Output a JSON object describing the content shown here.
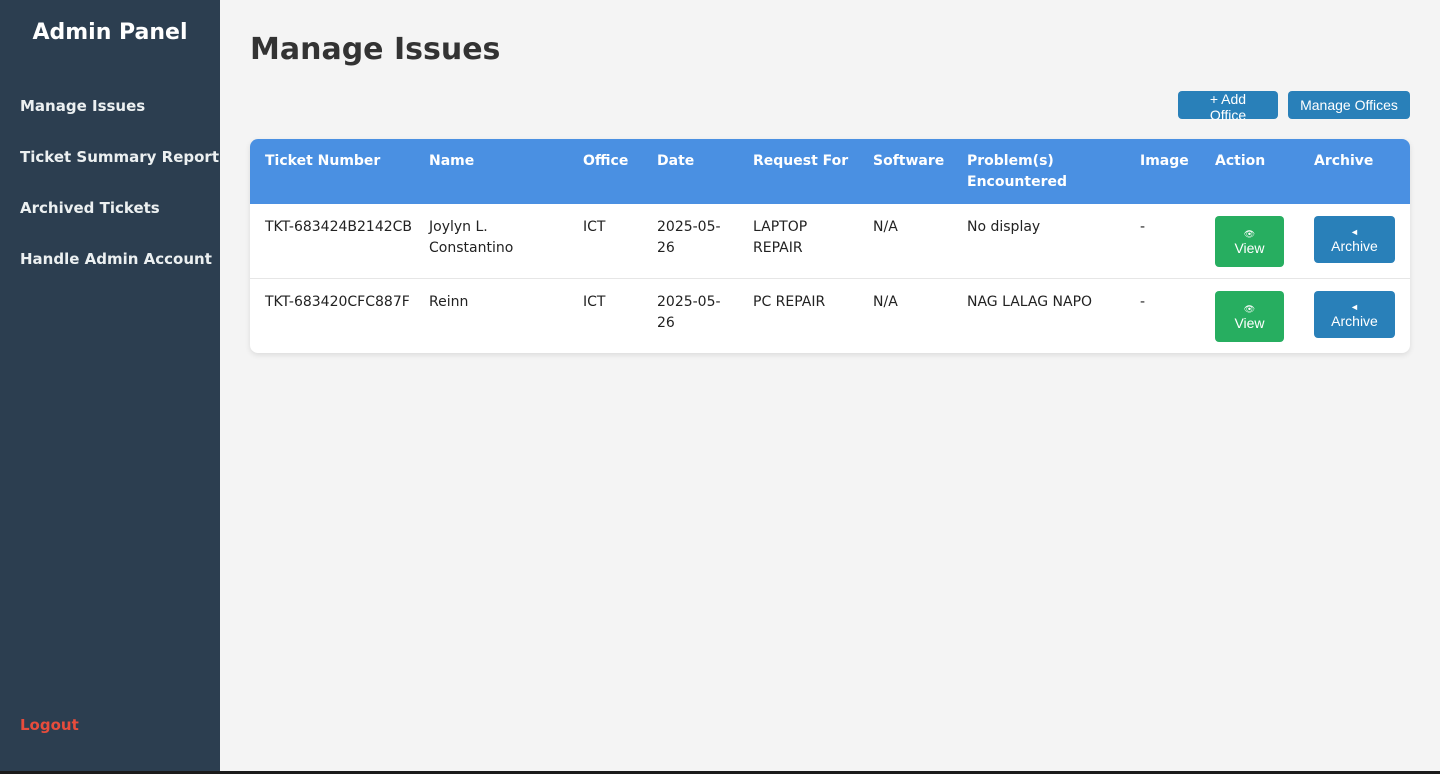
{
  "sidebar": {
    "title": "Admin Panel",
    "items": [
      {
        "label": "Manage Issues"
      },
      {
        "label": "Ticket Summary Report"
      },
      {
        "label": "Archived Tickets"
      },
      {
        "label": "Handle Admin Account"
      }
    ],
    "logout": "Logout"
  },
  "main": {
    "title": "Manage Issues",
    "add_office": "+ Add Office",
    "manage_offices": "Manage Offices"
  },
  "table": {
    "headers": {
      "ticket": "Ticket Number",
      "name": "Name",
      "office": "Office",
      "date": "Date",
      "request": "Request For",
      "software": "Software",
      "problems": "Problem(s) Encountered",
      "image": "Image",
      "action": "Action",
      "archive": "Archive"
    },
    "rows": [
      {
        "ticket": "TKT-683424B2142CB",
        "name": "Joylyn L. Constantino",
        "office": "ICT",
        "date": "2025-05-26",
        "request": "LAPTOP REPAIR",
        "software": "N/A",
        "problems": "No display",
        "image": "-",
        "view": "View",
        "archive": "Archive"
      },
      {
        "ticket": "TKT-683420CFC887F",
        "name": "Reinn",
        "office": "ICT",
        "date": "2025-05-26",
        "request": "PC REPAIR",
        "software": "N/A",
        "problems": "NAG LALAG NAPO",
        "image": "-",
        "view": "View",
        "archive": "Archive"
      }
    ]
  },
  "icons": {
    "view": "eye-icon",
    "archive": "archive-icon"
  },
  "colors": {
    "sidebar_bg": "#2c3e50",
    "table_header": "#4a90e2",
    "view_button": "#27ae60",
    "archive_button": "#2980b9",
    "logout": "#e74c3c"
  }
}
